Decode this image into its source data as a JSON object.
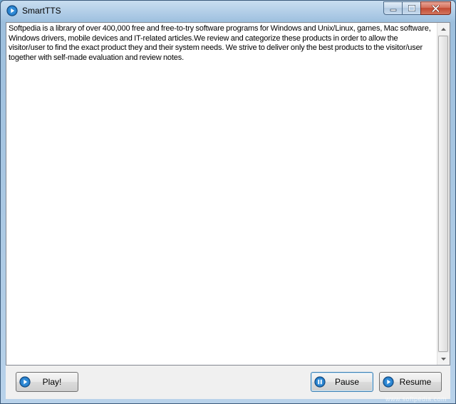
{
  "window": {
    "title": "SmartTTS"
  },
  "editor": {
    "text": "Softpedia is a library of over 400,000 free and free-to-try software programs for Windows and Unix/Linux, games, Mac software, Windows drivers, mobile devices and IT-related articles.We review and categorize these products in order to allow the visitor/user to find the exact product they and their system needs. We strive to deliver only the best products to the visitor/user together with self-made evaluation and review notes."
  },
  "buttons": {
    "play_label": "Play!",
    "pause_label": "Pause",
    "resume_label": "Resume"
  },
  "watermark": {
    "text": "www.softpedia.com"
  },
  "icons": {
    "app": "play-circle-icon",
    "play": "play-circle-icon",
    "pause": "pause-circle-icon",
    "resume": "play-circle-icon"
  },
  "colors": {
    "icon_blue": "#1f6fb8",
    "close_red": "#c24a32"
  }
}
